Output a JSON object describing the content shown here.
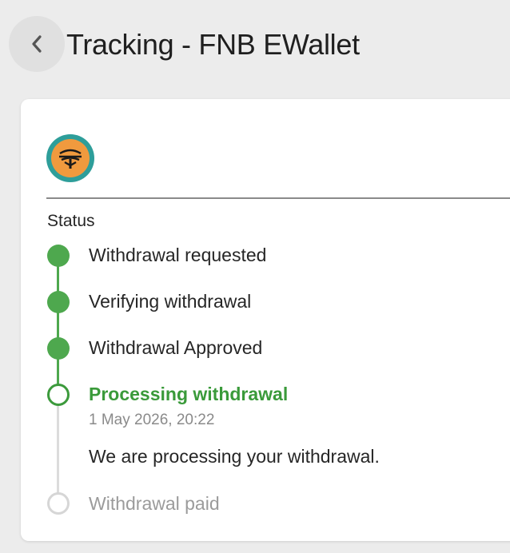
{
  "header": {
    "title": "Tracking - FNB EWallet"
  },
  "icons": {
    "back": "chevron-left-icon",
    "logo": "fnb-tree-logo"
  },
  "colors": {
    "complete": "#4ea84e",
    "active_text": "#3a9a3a",
    "pending": "#d6d6d6",
    "logo_ring": "#2e9e9a",
    "logo_fill": "#f09a3e"
  },
  "tracking": {
    "status_label": "Status",
    "steps": [
      {
        "label": "Withdrawal requested",
        "state": "complete"
      },
      {
        "label": "Verifying withdrawal",
        "state": "complete"
      },
      {
        "label": "Withdrawal Approved",
        "state": "complete"
      },
      {
        "label": "Processing withdrawal",
        "state": "current",
        "timestamp": "1 May 2026, 20:22",
        "description": "We are processing your withdrawal."
      },
      {
        "label": "Withdrawal paid",
        "state": "pending"
      }
    ]
  }
}
